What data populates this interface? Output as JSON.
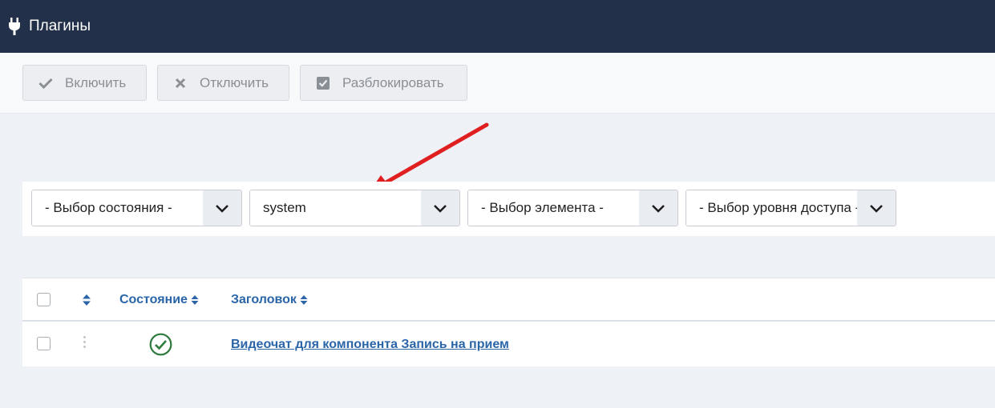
{
  "header": {
    "title": "Плагины",
    "icon": "plug-icon"
  },
  "toolbar": {
    "enable_label": "Включить",
    "disable_label": "Отключить",
    "unlock_label": "Разблокировать"
  },
  "filters": {
    "state": "- Выбор состояния -",
    "folder": "system",
    "element": "- Выбор элемента -",
    "access": "- Выбор уровня доступа -"
  },
  "table": {
    "headers": {
      "state": "Состояние",
      "title": "Заголовок"
    },
    "rows": [
      {
        "state": "enabled",
        "title": "Видеочат для компонента Запись на прием"
      }
    ]
  },
  "colors": {
    "header_bg": "#223049",
    "link": "#2a65a8",
    "annotation_arrow": "#e02020",
    "enabled_check": "#2f7a3e"
  }
}
